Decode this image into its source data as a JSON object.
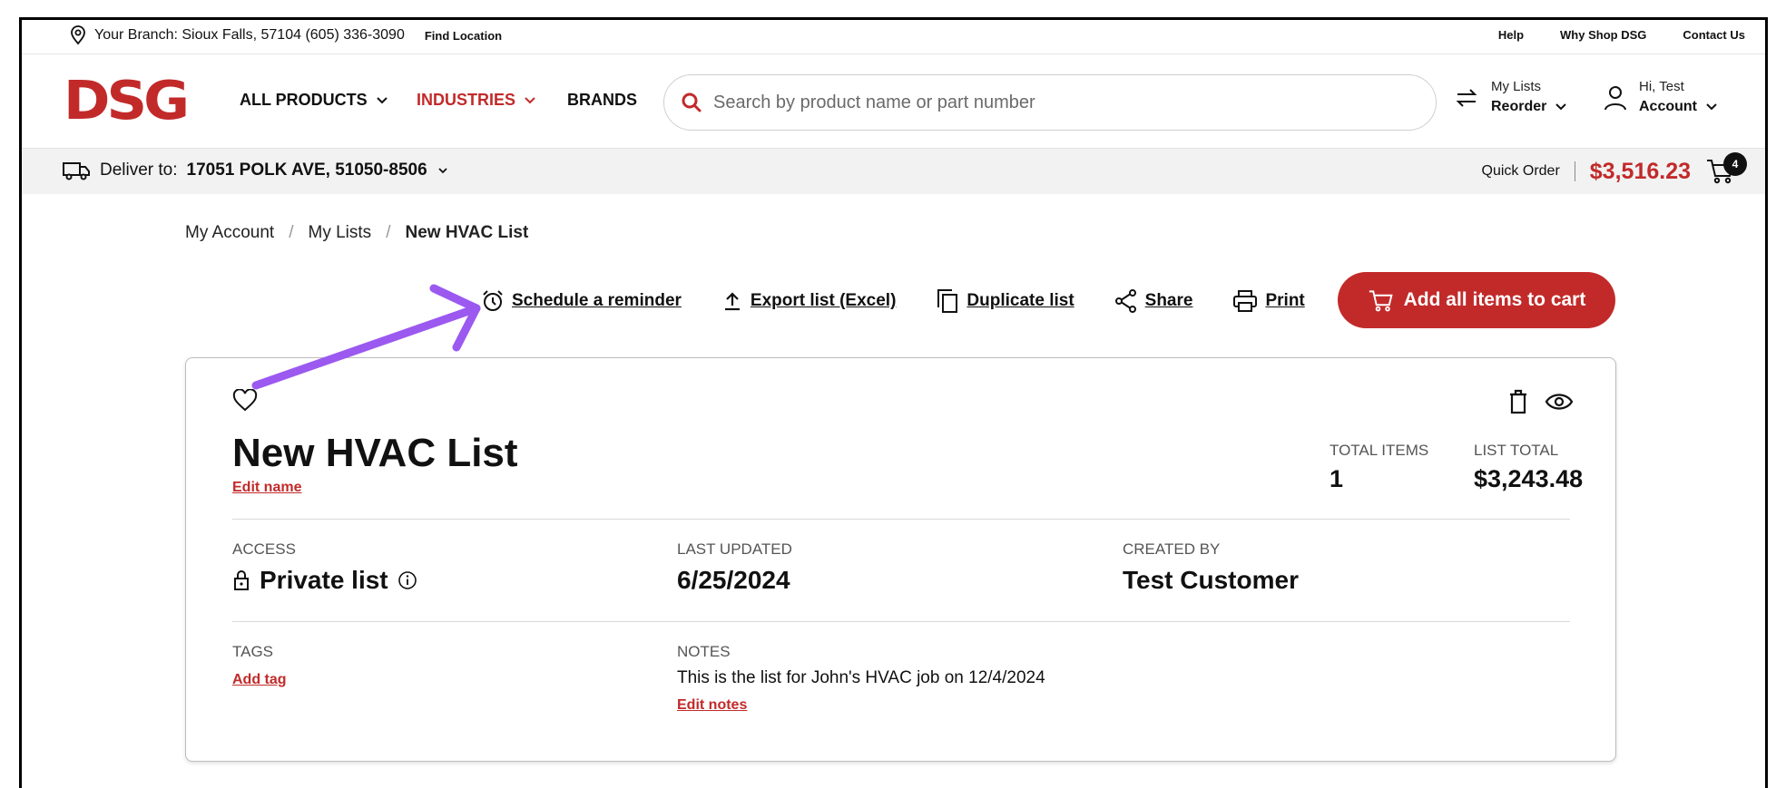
{
  "utility": {
    "branch": "Your Branch: Sioux Falls, 57104 (605) 336-3090",
    "find_location": "Find Location",
    "links": [
      "Help",
      "Why Shop DSG",
      "Contact Us"
    ]
  },
  "header": {
    "logo": "DSG",
    "nav": {
      "all_products": "ALL PRODUCTS",
      "industries": "INDUSTRIES",
      "brands": "BRANDS"
    },
    "search_placeholder": "Search by product name or part number",
    "lists": {
      "small": "My Lists",
      "big": "Reorder"
    },
    "account": {
      "small": "Hi, Test",
      "big": "Account"
    }
  },
  "delivery": {
    "label": "Deliver to:",
    "address": "17051 POLK AVE, 51050-8506",
    "quick_order": "Quick Order",
    "cart_total": "$3,516.23",
    "cart_count": "4"
  },
  "breadcrumb": {
    "items": [
      "My Account",
      "My Lists"
    ],
    "current": "New HVAC List"
  },
  "actions": {
    "schedule": "Schedule a reminder",
    "export": "Export list (Excel)",
    "duplicate": "Duplicate list",
    "share": "Share",
    "print": "Print",
    "add_all": "Add all items to cart"
  },
  "list": {
    "title": "New HVAC List",
    "edit_name": "Edit name",
    "total_items_label": "TOTAL ITEMS",
    "total_items": "1",
    "list_total_label": "LIST TOTAL",
    "list_total": "$3,243.48",
    "access_label": "ACCESS",
    "access": "Private list",
    "last_updated_label": "LAST UPDATED",
    "last_updated": "6/25/2024",
    "created_by_label": "CREATED BY",
    "created_by": "Test Customer",
    "tags_label": "TAGS",
    "add_tag": "Add tag",
    "notes_label": "NOTES",
    "notes": "This is the list for John's HVAC job on 12/4/2024",
    "edit_notes": "Edit notes"
  },
  "colors": {
    "brand_red": "#c22a2a",
    "annotation_purple": "#9b59f0"
  }
}
